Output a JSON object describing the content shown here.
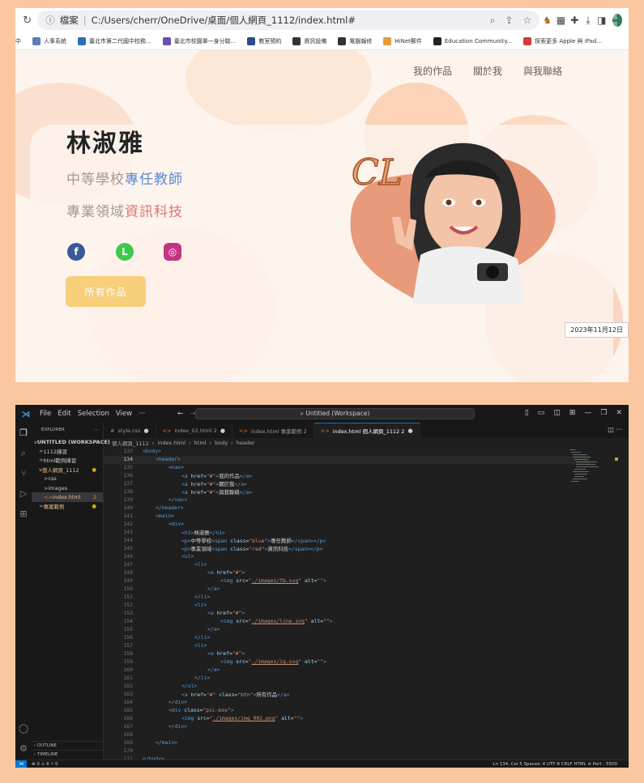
{
  "colors": {
    "frame_bg": "#fbc7a0",
    "accent_blue": "#5b8bd1",
    "accent_red": "#e07474",
    "button_yellow": "#f7cf7a",
    "vscode_bg": "#1f1f1f"
  },
  "browser": {
    "url_label": "檔案",
    "url": "C:/Users/cherr/OneDrive/桌面/個人網頁_1112/index.html#",
    "profile_badge": "巡徑",
    "bookmarks": [
      {
        "label": "中",
        "color": "#ffffff"
      },
      {
        "label": "人事系統",
        "color": "#5b7db8"
      },
      {
        "label": "臺北市第二代國中校務...",
        "color": "#2c6fb9"
      },
      {
        "label": "臺北市校園單一身分驗...",
        "color": "#6b4fb0"
      },
      {
        "label": "教室預約",
        "color": "#2a4c8f"
      },
      {
        "label": "資訊設備",
        "color": "#333333"
      },
      {
        "label": "電腦報修",
        "color": "#333333"
      },
      {
        "label": "HiNet郵件",
        "color": "#e79a3a"
      },
      {
        "label": "Education Community...",
        "color": "#222222"
      },
      {
        "label": "探索更多 Apple 與 iPad...",
        "color": "#d43a3a"
      }
    ]
  },
  "site": {
    "nav": [
      "我的作品",
      "關於我",
      "與我聯絡"
    ],
    "name": "林淑雅",
    "line1_prefix": "中等學校",
    "line1_highlight": "專任教師",
    "line2_prefix": "專業領域",
    "line2_highlight": "資訊科技",
    "social": [
      {
        "icon": "facebook-icon",
        "glyph": "f",
        "color": "#3b5998"
      },
      {
        "icon": "line-icon",
        "glyph": "L",
        "color": "#3ec94a"
      },
      {
        "icon": "instagram-icon",
        "glyph": "◎",
        "color": "#c13584"
      }
    ],
    "button": "所有作品",
    "logo_text": "CL"
  },
  "taskbar_date": "2023年11月12日",
  "vscode": {
    "menu": [
      "File",
      "Edit",
      "Selection",
      "View",
      "···"
    ],
    "search": "Untitled (Workspace)",
    "explorer_title": "EXPLORER",
    "tree": [
      {
        "label": "UNTITLED (WORKSPACE)",
        "indent": 0,
        "caret": "v",
        "active": false,
        "badge": "",
        "color": "#cccccc"
      },
      {
        "label": "1112練習",
        "indent": 1,
        "caret": ">",
        "active": false,
        "badge": "",
        "color": "#cccccc"
      },
      {
        "label": "html範例練習",
        "indent": 1,
        "caret": ">",
        "active": false,
        "badge": "",
        "color": "#cccccc"
      },
      {
        "label": "個人網頁_1112",
        "indent": 1,
        "caret": "v",
        "active": false,
        "badge": "●",
        "color": "#e2c08d"
      },
      {
        "label": "css",
        "indent": 2,
        "caret": ">",
        "active": false,
        "badge": "",
        "color": "#cccccc"
      },
      {
        "label": "images",
        "indent": 2,
        "caret": ">",
        "active": false,
        "badge": "",
        "color": "#cccccc"
      },
      {
        "label": "index.html",
        "indent": 2,
        "caret": "<>",
        "active": true,
        "badge": "2",
        "color": "#e2c08d"
      },
      {
        "label": "專案範例",
        "indent": 1,
        "caret": ">",
        "active": false,
        "badge": "●",
        "color": "#e2c08d"
      }
    ],
    "outline": "OUTLINE",
    "timeline": "TIMELINE",
    "tabs": [
      {
        "label": "style.css",
        "kind": "#",
        "active": false,
        "mark": "●"
      },
      {
        "label": "index_02.html 2",
        "kind": "<>",
        "active": false,
        "mark": "●"
      },
      {
        "label": "index.html 專案範例 2",
        "kind": "<>",
        "active": false,
        "mark": ""
      },
      {
        "label": "index.html 個人網頁_1112 2",
        "kind": "<>",
        "active": true,
        "mark": "●"
      }
    ],
    "breadcrumb": [
      "個人網頁_1112",
      "index.html",
      "html",
      "body",
      "header"
    ],
    "current_line": 134,
    "status_left": "⊗ 0 ⚠ 6   ⚡ 0",
    "status_right": "Ln 134, Col 5   Spaces: 4   UTF-8   CRLF   HTML   ⊘ Port : 5500",
    "code": [
      {
        "n": 133,
        "indent": 0,
        "html": "<span class='tag'>&lt;body&gt;</span>"
      },
      {
        "n": 134,
        "indent": 1,
        "html": "<span class='tag'>&lt;header&gt;</span>"
      },
      {
        "n": 135,
        "indent": 2,
        "html": "<span class='tag'>&lt;nav&gt;</span>"
      },
      {
        "n": 136,
        "indent": 3,
        "html": "<span class='tag'>&lt;a</span> <span class='attr'>href</span>=<span class='str'>\"#\"</span><span class='tag'>&gt;</span><span class='txt'>我的作品</span><span class='tag'>&lt;/a&gt;</span>"
      },
      {
        "n": 137,
        "indent": 3,
        "html": "<span class='tag'>&lt;a</span> <span class='attr'>href</span>=<span class='str'>\"#\"</span><span class='tag'>&gt;</span><span class='txt'>關於我</span><span class='tag'>&lt;/a&gt;</span>"
      },
      {
        "n": 138,
        "indent": 3,
        "html": "<span class='tag'>&lt;a</span> <span class='attr'>href</span>=<span class='str'>\"#\"</span><span class='tag'>&gt;</span><span class='txt'>與我聯絡</span><span class='tag'>&lt;/a&gt;</span>"
      },
      {
        "n": 139,
        "indent": 2,
        "html": "<span class='tag'>&lt;/nav&gt;</span>"
      },
      {
        "n": 140,
        "indent": 1,
        "html": "<span class='tag'>&lt;/header&gt;</span>"
      },
      {
        "n": 141,
        "indent": 1,
        "html": "<span class='tag'>&lt;main&gt;</span>"
      },
      {
        "n": 142,
        "indent": 2,
        "html": "<span class='tag'>&lt;div&gt;</span>"
      },
      {
        "n": 143,
        "indent": 3,
        "html": "<span class='tag'>&lt;h1&gt;</span><span class='txt'>林淑雅</span><span class='tag'>&lt;/h1&gt;</span>"
      },
      {
        "n": 144,
        "indent": 3,
        "html": "<span class='tag'>&lt;p&gt;</span><span class='txt'>中等學校</span><span class='tag'>&lt;span</span> <span class='attr'>class</span>=<span class='str'>\"blue\"</span><span class='tag'>&gt;</span><span class='txt'>專任教師</span><span class='tag'>&lt;/span&gt;&lt;/p&gt;</span>"
      },
      {
        "n": 145,
        "indent": 3,
        "html": "<span class='tag'>&lt;p&gt;</span><span class='txt'>專業領域</span><span class='tag'>&lt;span</span> <span class='attr'>class</span>=<span class='str'>\"red\"</span><span class='tag'>&gt;</span><span class='txt'>資訊科技</span><span class='tag'>&lt;/span&gt;&lt;/p&gt;</span>"
      },
      {
        "n": 146,
        "indent": 3,
        "html": "<span class='tag'>&lt;ul&gt;</span>"
      },
      {
        "n": 147,
        "indent": 4,
        "html": "<span class='tag'>&lt;li&gt;</span>"
      },
      {
        "n": 148,
        "indent": 5,
        "html": "<span class='tag'>&lt;a</span> <span class='attr'>href</span>=<span class='str'>\"#\"</span><span class='tag'>&gt;</span>"
      },
      {
        "n": 149,
        "indent": 6,
        "html": "<span class='tag'>&lt;img</span> <span class='attr'>src</span>=<span class='str'>\"<u>./images/fb.svg</u>\"</span> <span class='attr'>alt</span>=<span class='str'>\"\"</span><span class='tag'>&gt;</span>"
      },
      {
        "n": 150,
        "indent": 5,
        "html": "<span class='tag'>&lt;/a&gt;</span>"
      },
      {
        "n": 151,
        "indent": 4,
        "html": "<span class='tag'>&lt;/li&gt;</span>"
      },
      {
        "n": 152,
        "indent": 4,
        "html": "<span class='tag'>&lt;li&gt;</span>"
      },
      {
        "n": 153,
        "indent": 5,
        "html": "<span class='tag'>&lt;a</span> <span class='attr'>href</span>=<span class='str'>\"#\"</span><span class='tag'>&gt;</span>"
      },
      {
        "n": 154,
        "indent": 6,
        "html": "<span class='tag'>&lt;img</span> <span class='attr'>src</span>=<span class='str'>\"<u>./images/line.svg</u>\"</span> <span class='attr'>alt</span>=<span class='str'>\"\"</span><span class='tag'>&gt;</span>"
      },
      {
        "n": 155,
        "indent": 5,
        "html": "<span class='tag'>&lt;/a&gt;</span>"
      },
      {
        "n": 156,
        "indent": 4,
        "html": "<span class='tag'>&lt;/li&gt;</span>"
      },
      {
        "n": 157,
        "indent": 4,
        "html": "<span class='tag'>&lt;li&gt;</span>"
      },
      {
        "n": 158,
        "indent": 5,
        "html": "<span class='tag'>&lt;a</span> <span class='attr'>href</span>=<span class='str'>\"#\"</span><span class='tag'>&gt;</span>"
      },
      {
        "n": 159,
        "indent": 6,
        "html": "<span class='tag'>&lt;img</span> <span class='attr'>src</span>=<span class='str'>\"<u>./images/ig.svg</u>\"</span> <span class='attr'>alt</span>=<span class='str'>\"\"</span><span class='tag'>&gt;</span>"
      },
      {
        "n": 160,
        "indent": 5,
        "html": "<span class='tag'>&lt;/a&gt;</span>"
      },
      {
        "n": 161,
        "indent": 4,
        "html": "<span class='tag'>&lt;/li&gt;</span>"
      },
      {
        "n": 162,
        "indent": 3,
        "html": "<span class='tag'>&lt;/ul&gt;</span>"
      },
      {
        "n": 163,
        "indent": 3,
        "html": "<span class='tag'>&lt;a</span> <span class='attr'>href</span>=<span class='str'>\"#\"</span> <span class='attr'>class</span>=<span class='str'>\"btn\"</span><span class='tag'>&gt;</span><span class='txt'>所有作品</span><span class='tag'>&lt;/a&gt;</span>"
      },
      {
        "n": 164,
        "indent": 2,
        "html": "<span class='tag'>&lt;/div&gt;</span>"
      },
      {
        "n": 165,
        "indent": 2,
        "html": "<span class='tag'>&lt;div</span> <span class='attr'>class</span>=<span class='str'>\"pic-box\"</span><span class='tag'>&gt;</span>"
      },
      {
        "n": 166,
        "indent": 3,
        "html": "<span class='tag'>&lt;img</span> <span class='attr'>src</span>=<span class='str'>\"<u>./images/img_002.png</u>\"</span> <span class='attr'>alt</span>=<span class='str'>\"\"</span><span class='tag'>&gt;</span>"
      },
      {
        "n": 167,
        "indent": 2,
        "html": "<span class='tag'>&lt;/div&gt;</span>"
      },
      {
        "n": 168,
        "indent": 0,
        "html": ""
      },
      {
        "n": 169,
        "indent": 1,
        "html": "<span class='tag'>&lt;/main&gt;</span>"
      },
      {
        "n": 170,
        "indent": 0,
        "html": ""
      },
      {
        "n": 171,
        "indent": 0,
        "html": "<span class='tag'>&lt;/body&gt;</span>"
      }
    ]
  }
}
